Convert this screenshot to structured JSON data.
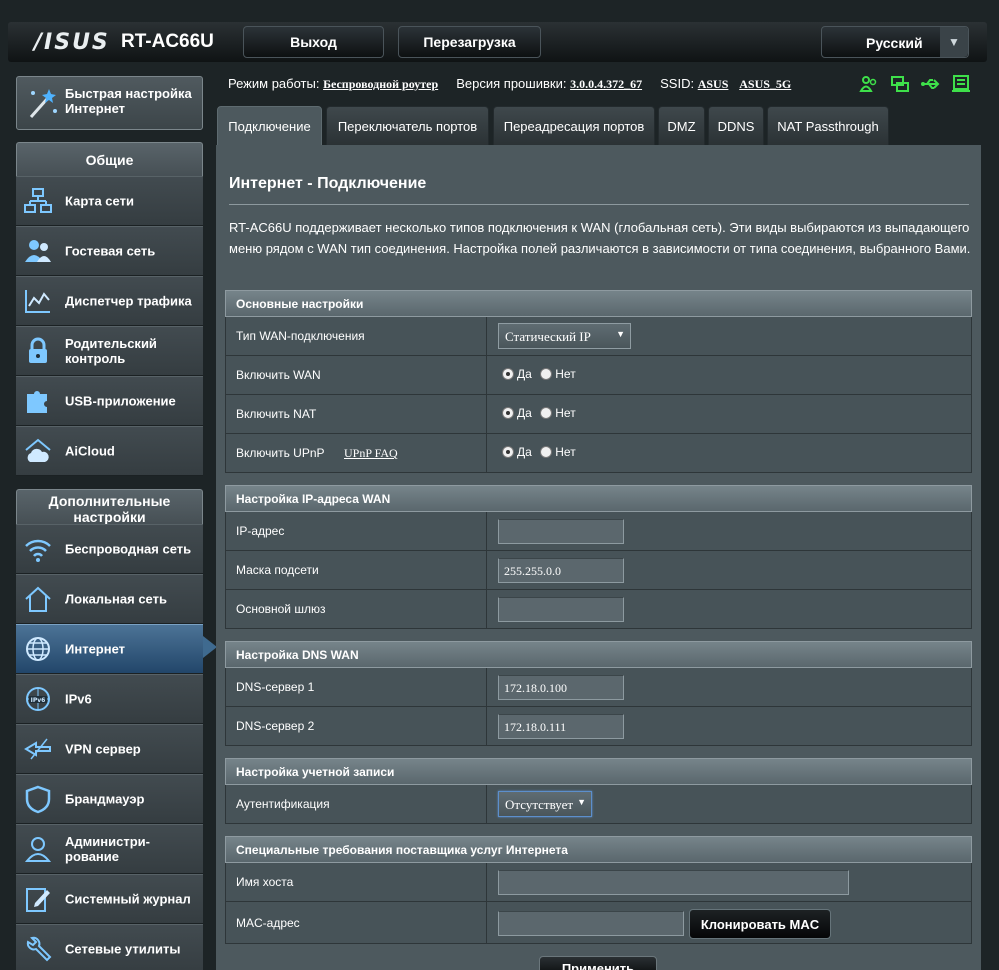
{
  "header": {
    "logo": "/ISUS",
    "model": "RT-AC66U",
    "logout_label": "Выход",
    "reboot_label": "Перезагрузка",
    "language": "Русский"
  },
  "sidebar": {
    "quick_setup": "Быстрая настройка Интернет",
    "general_title": "Общие",
    "general_items": [
      "Карта сети",
      "Гостевая сеть",
      "Диспетчер трафика",
      "Родительский контроль",
      "USB-приложение",
      "AiCloud"
    ],
    "advanced_title": "Дополнительные настройки",
    "advanced_items": [
      "Беспроводная сеть",
      "Локальная сеть",
      "Интернет",
      "IPv6",
      "VPN сервер",
      "Брандмауэр",
      "Администри-рование",
      "Системный журнал",
      "Сетевые утилиты"
    ]
  },
  "status": {
    "mode_label": "Режим работы:",
    "mode_value": "Беспроводной роутер",
    "firmware_label": "Версия прошивки:",
    "firmware_value": "3.0.0.4.372_67",
    "ssid_label": "SSID:",
    "ssid_1": "ASUS",
    "ssid_2": "ASUS_5G"
  },
  "tabs": [
    "Подключение",
    "Переключатель портов",
    "Переадресация портов",
    "DMZ",
    "DDNS",
    "NAT Passthrough"
  ],
  "page": {
    "title": "Интернет - Подключение",
    "description": "RT-AC66U поддерживает несколько типов подключения к WAN (глобальная сеть). Эти виды выбираются из выпадающего меню рядом с WAN тип соединения. Настройка полей различаются в зависимости от типа соединения, выбранного Вами."
  },
  "basic": {
    "title": "Основные настройки",
    "wan_type_label": "Тип WAN-подключения",
    "wan_type_value": "Статический IP",
    "enable_wan_label": "Включить WAN",
    "enable_nat_label": "Включить NAT",
    "enable_upnp_label": "Включить UPnP",
    "upnp_faq": "UPnP FAQ",
    "yes": "Да",
    "no": "Нет"
  },
  "ip": {
    "title": "Настройка IP-адреса WAN",
    "ip_label": "IP-адрес",
    "ip_value": "",
    "mask_label": "Маска подсети",
    "mask_value": "255.255.0.0",
    "gateway_label": "Основной шлюз",
    "gateway_value": ""
  },
  "dns": {
    "title": "Настройка DNS WAN",
    "dns1_label": "DNS-сервер 1",
    "dns1_value": "172.18.0.100",
    "dns2_label": "DNS-сервер 2",
    "dns2_value": "172.18.0.111"
  },
  "account": {
    "title": "Настройка учетной записи",
    "auth_label": "Аутентификация",
    "auth_value": "Отсутствует"
  },
  "isp": {
    "title": "Специальные требования поставщика услуг Интернета",
    "hostname_label": "Имя хоста",
    "hostname_value": "",
    "mac_label": "MAC-адрес",
    "mac_value": "",
    "clone_mac": "Клонировать MAC"
  },
  "apply_label": "Применить"
}
